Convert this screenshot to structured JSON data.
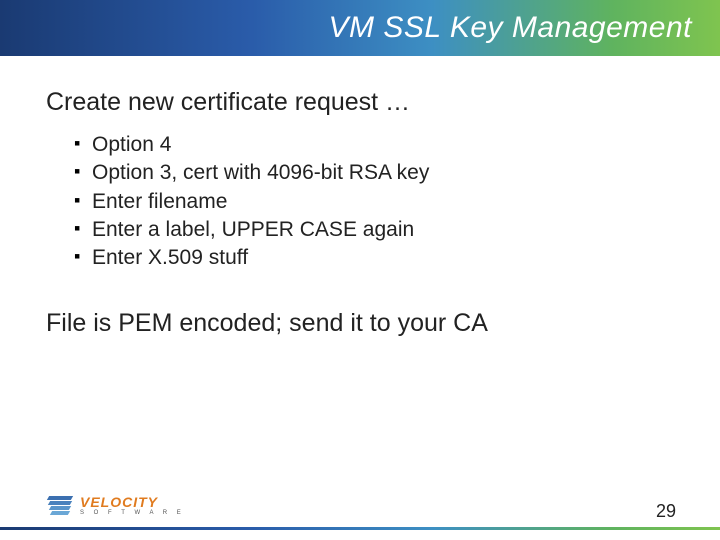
{
  "header": {
    "title": "VM SSL Key Management"
  },
  "content": {
    "heading1": "Create new certificate request …",
    "bullets": [
      "Option 4",
      "Option 3, cert with 4096-bit RSA key",
      "Enter filename",
      "Enter a label, UPPER CASE again",
      "Enter X.509 stuff"
    ],
    "heading2": "File is PEM encoded; send it to your CA"
  },
  "footer": {
    "logo_name": "VELOCITY",
    "logo_sub": "S O F T W A R E",
    "page_number": "29"
  }
}
